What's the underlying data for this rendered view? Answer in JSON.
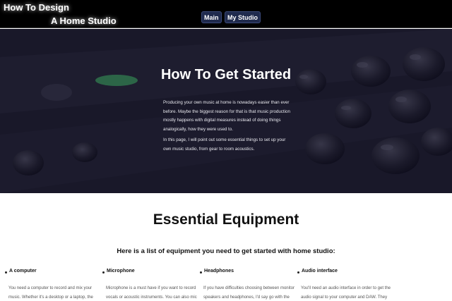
{
  "header": {
    "logo_line1": "How To Design",
    "logo_line2": "A Home Studio",
    "nav": [
      {
        "label": "Main"
      },
      {
        "label": "My Studio"
      }
    ]
  },
  "hero": {
    "title": "How To Get Started",
    "paragraph1": "Producing your own music at home is nowadays easier than ever before. Maybe the biggest reason for that is that music production mostly happens with digital measures instead of doing things analogically, how they were used to.",
    "paragraph2": "In this page, I will point out some essential things to set up your own music studio, from gear to room acoustics."
  },
  "equipment": {
    "title": "Essential Equipment",
    "subtitle": "Here is a list of equipment you need to get started with home studio:",
    "items": [
      {
        "title": "A computer",
        "text": "You need a computer to record and mix your music. Whether it's a desktop or a laptop, the choice is yours to"
      },
      {
        "title": "Microphone",
        "text": "Microphone is a must have if you want to record vocals or acoustic instruments. You can also mic up guitar or"
      },
      {
        "title": "Headphones",
        "text": "If you have difficulties choosing between monitor speakers and headphones, I'd say go with the"
      },
      {
        "title": "Audio interface",
        "text": "You'll need an audio interface in order to get the audio signal to your computer and DAW. They usually come"
      }
    ]
  }
}
